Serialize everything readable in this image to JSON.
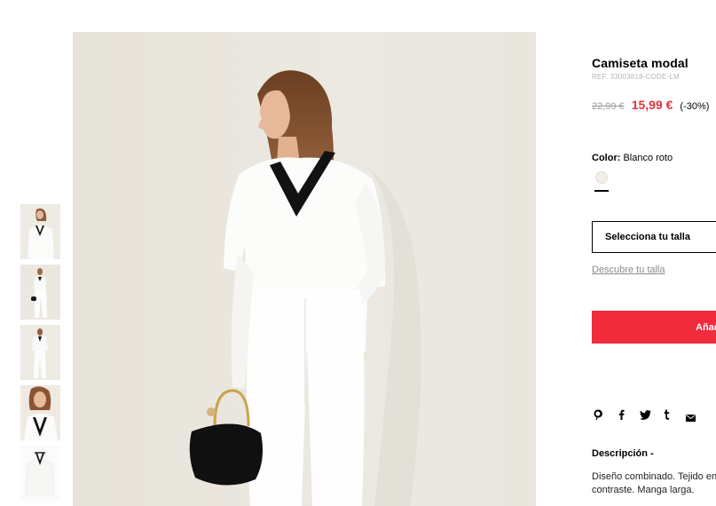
{
  "product": {
    "title": "Camiseta modal",
    "ref": "REF. 33003818-CODE-LM",
    "old_price": "22,99 €",
    "new_price": "15,99 €",
    "discount": "(-30%)",
    "color_label": "Color:",
    "color_value": "Blanco roto",
    "color_swatch_hex": "#f1efe8",
    "size_select_label": "Selecciona tu talla",
    "size_guide_link": "Descubre tu talla",
    "add_button_label": "Añadir",
    "description_title": "Descripción -",
    "description_text": "Diseño combinado. Tejido en contraste. Manga larga."
  },
  "share": {
    "icons": [
      "pinterest-icon",
      "facebook-icon",
      "twitter-icon",
      "tumblr-icon",
      "email-icon"
    ]
  },
  "colors": {
    "accent": "#f02b3c",
    "sale_price": "#e8303d",
    "background": "#ebe8e1"
  }
}
